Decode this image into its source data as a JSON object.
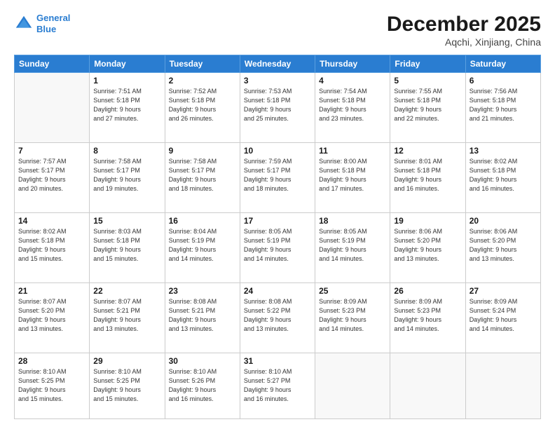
{
  "header": {
    "logo_line1": "General",
    "logo_line2": "Blue",
    "month": "December 2025",
    "location": "Aqchi, Xinjiang, China"
  },
  "weekdays": [
    "Sunday",
    "Monday",
    "Tuesday",
    "Wednesday",
    "Thursday",
    "Friday",
    "Saturday"
  ],
  "weeks": [
    [
      {
        "day": "",
        "info": ""
      },
      {
        "day": "1",
        "info": "Sunrise: 7:51 AM\nSunset: 5:18 PM\nDaylight: 9 hours\nand 27 minutes."
      },
      {
        "day": "2",
        "info": "Sunrise: 7:52 AM\nSunset: 5:18 PM\nDaylight: 9 hours\nand 26 minutes."
      },
      {
        "day": "3",
        "info": "Sunrise: 7:53 AM\nSunset: 5:18 PM\nDaylight: 9 hours\nand 25 minutes."
      },
      {
        "day": "4",
        "info": "Sunrise: 7:54 AM\nSunset: 5:18 PM\nDaylight: 9 hours\nand 23 minutes."
      },
      {
        "day": "5",
        "info": "Sunrise: 7:55 AM\nSunset: 5:18 PM\nDaylight: 9 hours\nand 22 minutes."
      },
      {
        "day": "6",
        "info": "Sunrise: 7:56 AM\nSunset: 5:18 PM\nDaylight: 9 hours\nand 21 minutes."
      }
    ],
    [
      {
        "day": "7",
        "info": "Sunrise: 7:57 AM\nSunset: 5:17 PM\nDaylight: 9 hours\nand 20 minutes."
      },
      {
        "day": "8",
        "info": "Sunrise: 7:58 AM\nSunset: 5:17 PM\nDaylight: 9 hours\nand 19 minutes."
      },
      {
        "day": "9",
        "info": "Sunrise: 7:58 AM\nSunset: 5:17 PM\nDaylight: 9 hours\nand 18 minutes."
      },
      {
        "day": "10",
        "info": "Sunrise: 7:59 AM\nSunset: 5:17 PM\nDaylight: 9 hours\nand 18 minutes."
      },
      {
        "day": "11",
        "info": "Sunrise: 8:00 AM\nSunset: 5:18 PM\nDaylight: 9 hours\nand 17 minutes."
      },
      {
        "day": "12",
        "info": "Sunrise: 8:01 AM\nSunset: 5:18 PM\nDaylight: 9 hours\nand 16 minutes."
      },
      {
        "day": "13",
        "info": "Sunrise: 8:02 AM\nSunset: 5:18 PM\nDaylight: 9 hours\nand 16 minutes."
      }
    ],
    [
      {
        "day": "14",
        "info": "Sunrise: 8:02 AM\nSunset: 5:18 PM\nDaylight: 9 hours\nand 15 minutes."
      },
      {
        "day": "15",
        "info": "Sunrise: 8:03 AM\nSunset: 5:18 PM\nDaylight: 9 hours\nand 15 minutes."
      },
      {
        "day": "16",
        "info": "Sunrise: 8:04 AM\nSunset: 5:19 PM\nDaylight: 9 hours\nand 14 minutes."
      },
      {
        "day": "17",
        "info": "Sunrise: 8:05 AM\nSunset: 5:19 PM\nDaylight: 9 hours\nand 14 minutes."
      },
      {
        "day": "18",
        "info": "Sunrise: 8:05 AM\nSunset: 5:19 PM\nDaylight: 9 hours\nand 14 minutes."
      },
      {
        "day": "19",
        "info": "Sunrise: 8:06 AM\nSunset: 5:20 PM\nDaylight: 9 hours\nand 13 minutes."
      },
      {
        "day": "20",
        "info": "Sunrise: 8:06 AM\nSunset: 5:20 PM\nDaylight: 9 hours\nand 13 minutes."
      }
    ],
    [
      {
        "day": "21",
        "info": "Sunrise: 8:07 AM\nSunset: 5:20 PM\nDaylight: 9 hours\nand 13 minutes."
      },
      {
        "day": "22",
        "info": "Sunrise: 8:07 AM\nSunset: 5:21 PM\nDaylight: 9 hours\nand 13 minutes."
      },
      {
        "day": "23",
        "info": "Sunrise: 8:08 AM\nSunset: 5:21 PM\nDaylight: 9 hours\nand 13 minutes."
      },
      {
        "day": "24",
        "info": "Sunrise: 8:08 AM\nSunset: 5:22 PM\nDaylight: 9 hours\nand 13 minutes."
      },
      {
        "day": "25",
        "info": "Sunrise: 8:09 AM\nSunset: 5:23 PM\nDaylight: 9 hours\nand 14 minutes."
      },
      {
        "day": "26",
        "info": "Sunrise: 8:09 AM\nSunset: 5:23 PM\nDaylight: 9 hours\nand 14 minutes."
      },
      {
        "day": "27",
        "info": "Sunrise: 8:09 AM\nSunset: 5:24 PM\nDaylight: 9 hours\nand 14 minutes."
      }
    ],
    [
      {
        "day": "28",
        "info": "Sunrise: 8:10 AM\nSunset: 5:25 PM\nDaylight: 9 hours\nand 15 minutes."
      },
      {
        "day": "29",
        "info": "Sunrise: 8:10 AM\nSunset: 5:25 PM\nDaylight: 9 hours\nand 15 minutes."
      },
      {
        "day": "30",
        "info": "Sunrise: 8:10 AM\nSunset: 5:26 PM\nDaylight: 9 hours\nand 16 minutes."
      },
      {
        "day": "31",
        "info": "Sunrise: 8:10 AM\nSunset: 5:27 PM\nDaylight: 9 hours\nand 16 minutes."
      },
      {
        "day": "",
        "info": ""
      },
      {
        "day": "",
        "info": ""
      },
      {
        "day": "",
        "info": ""
      }
    ]
  ]
}
